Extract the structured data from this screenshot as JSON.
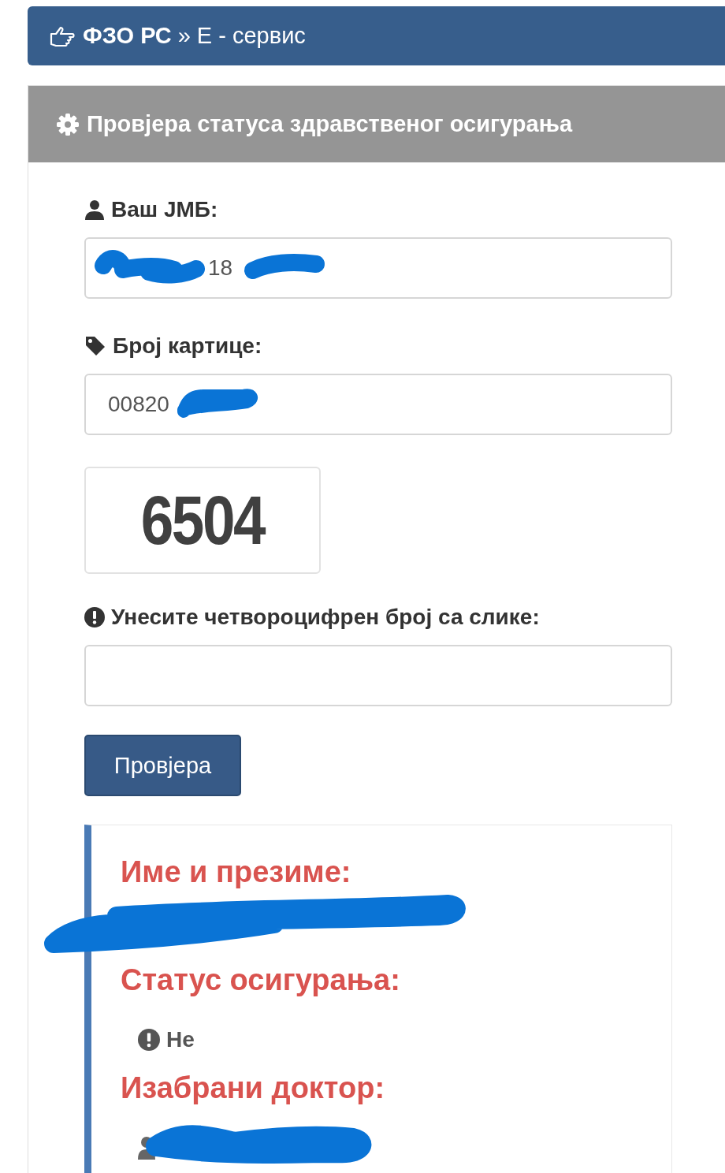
{
  "header": {
    "site": "ФЗО РС",
    "separator": "»",
    "page": "Е - сервис"
  },
  "panel": {
    "title": "Провјера статуса здравственог осигурања"
  },
  "fields": [
    {
      "kind": "person",
      "label": "Ваш JMБ:",
      "value": "18"
    },
    {
      "kind": "tag",
      "label": "Број картице:",
      "value": "00820"
    }
  ],
  "captcha": {
    "code": "6504"
  },
  "captcha_field": {
    "label": "Унесите четвороцифрен број са слике:"
  },
  "button": "Провјера",
  "result": {
    "sections": [
      {
        "kind": "name",
        "label": "Име и презиме:"
      },
      {
        "kind": "status",
        "label": "Статус осигурања:",
        "value": "Не"
      },
      {
        "kind": "doctor",
        "label": "Изабрани доктор:"
      }
    ]
  }
}
